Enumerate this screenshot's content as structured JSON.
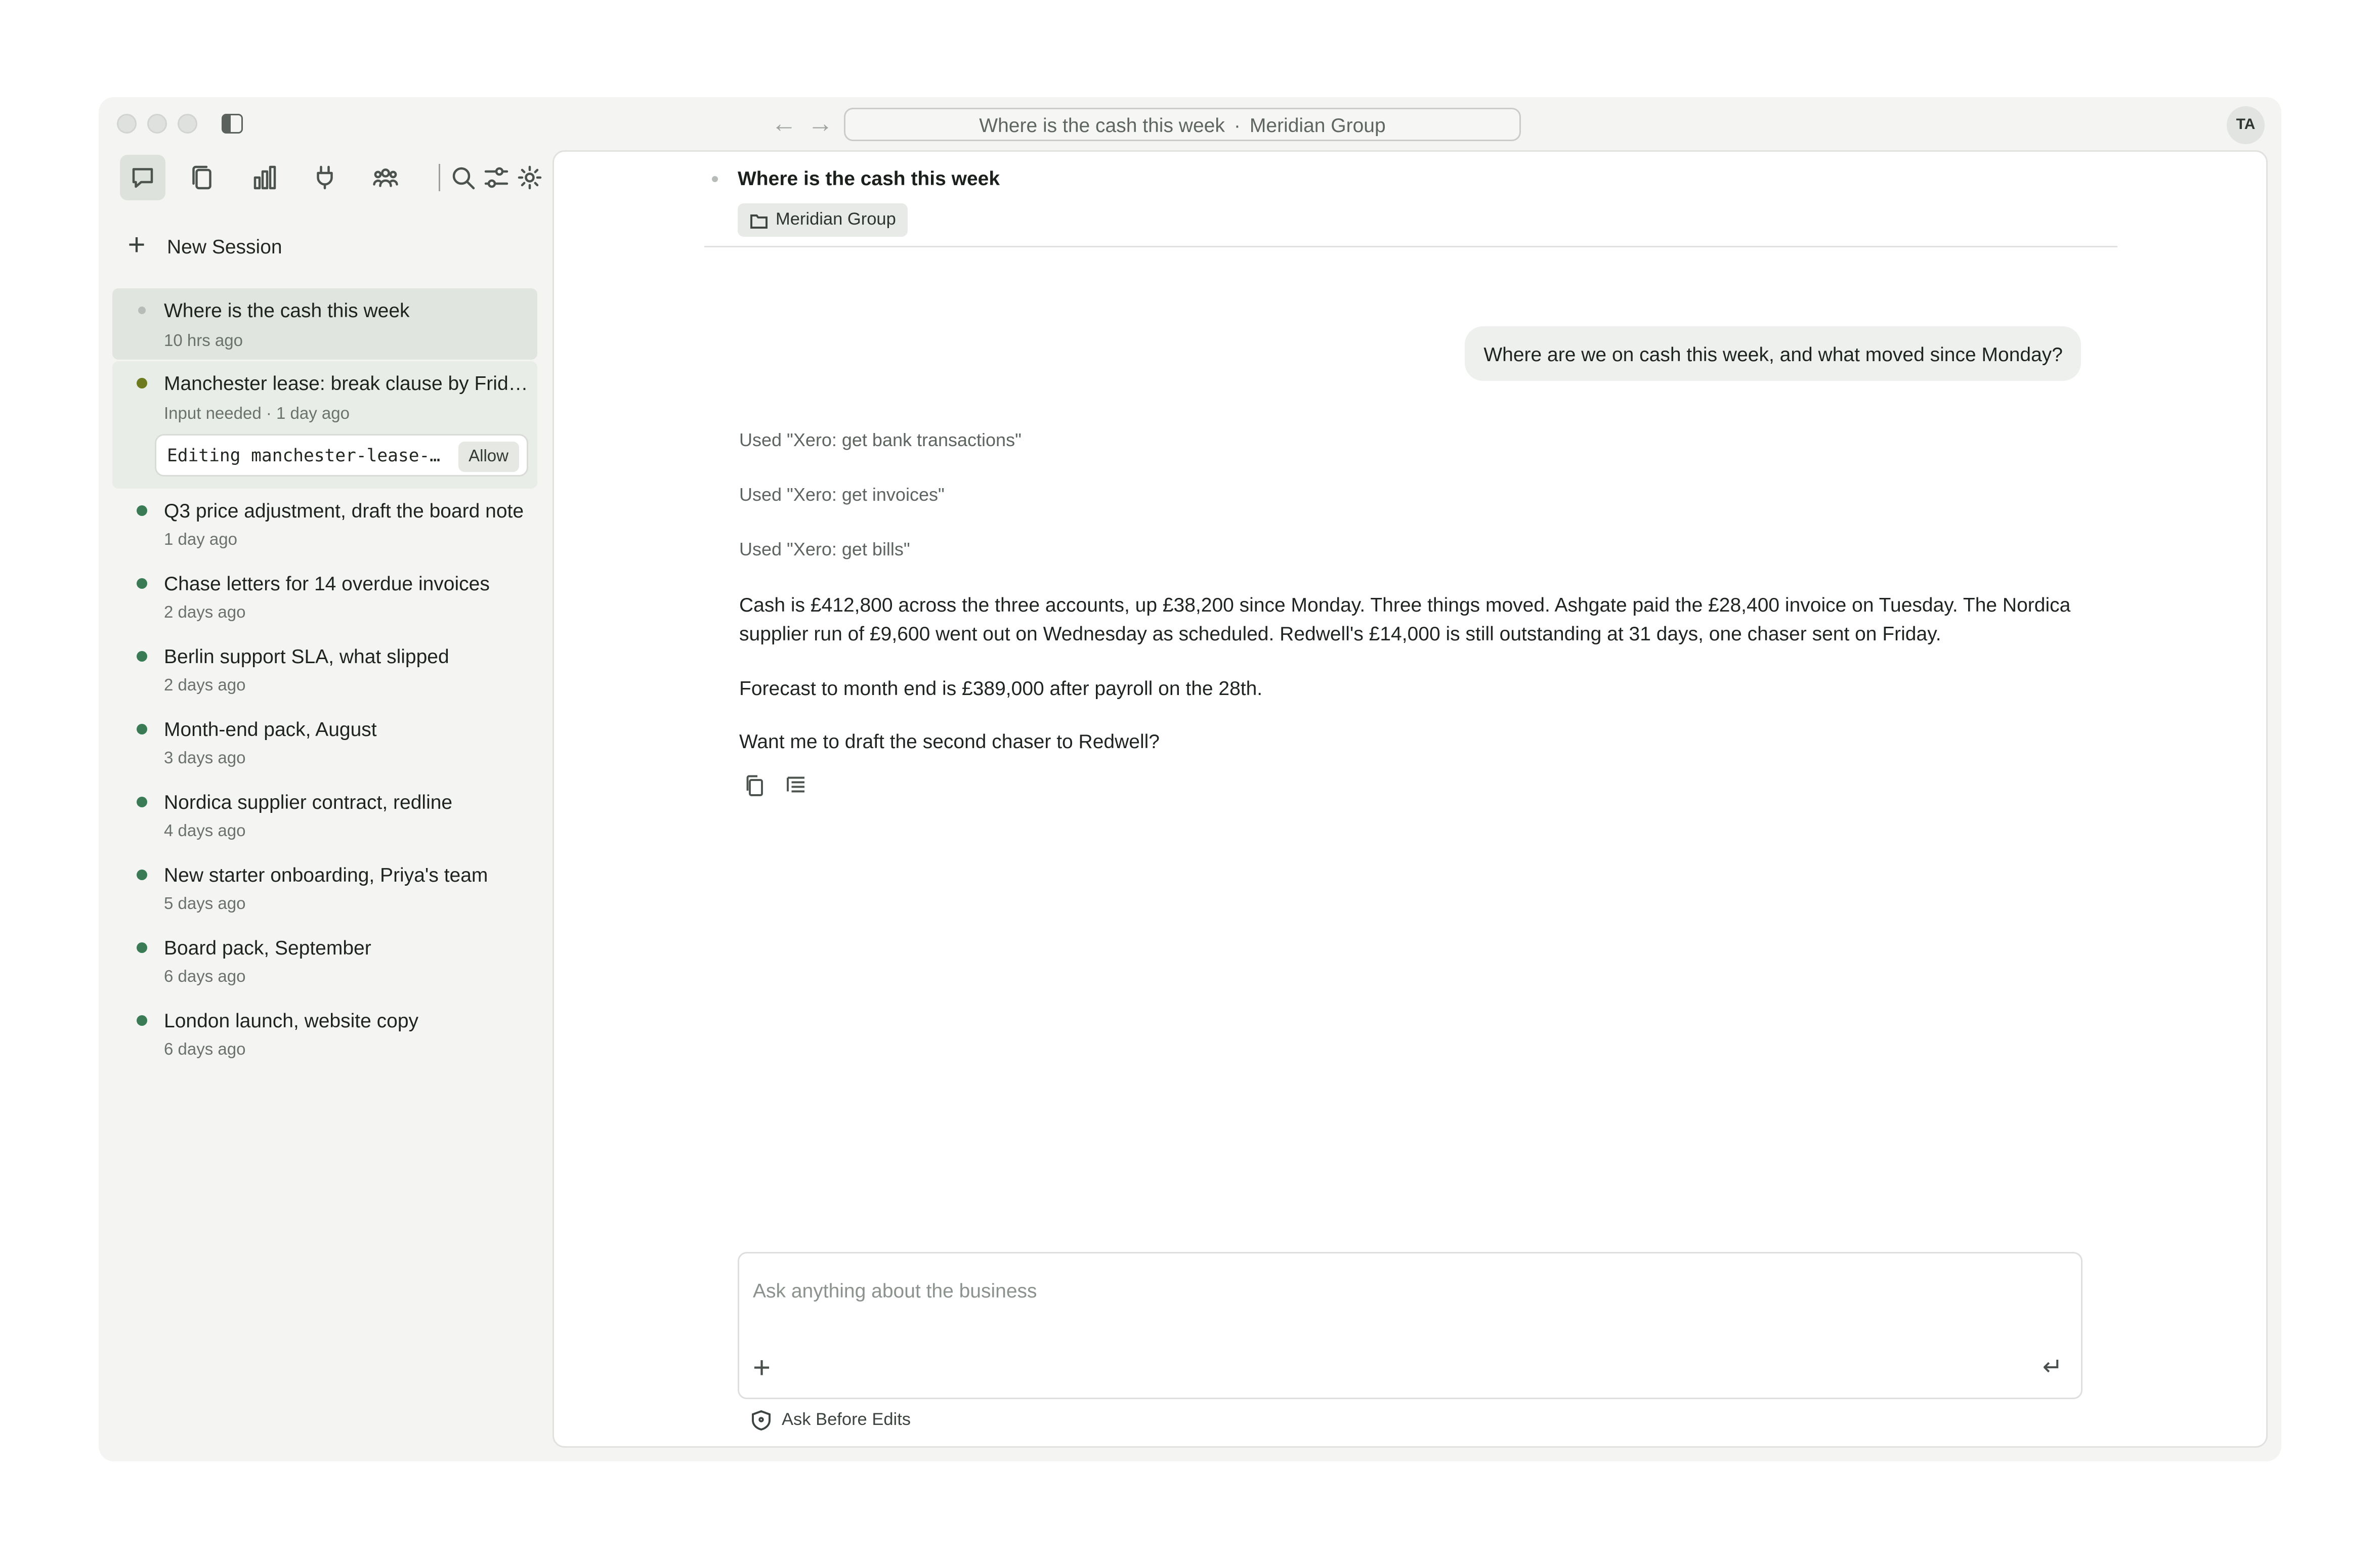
{
  "window": {
    "address_title": "Where is the cash this week",
    "address_separator": "·",
    "address_workspace": "Meridian Group",
    "avatar_initials": "TA"
  },
  "sidebar": {
    "toolbar_icons": [
      "chat-icon",
      "documents-icon",
      "chart-icon",
      "plug-icon",
      "team-icon",
      "search-icon",
      "sliders-icon",
      "gear-icon"
    ],
    "new_session_label": "New Session",
    "sessions": [
      {
        "title": "Where is the cash this week",
        "meta": "10 hrs ago",
        "status": "current"
      },
      {
        "title": "Manchester lease: break clause by Friday",
        "meta": "Input needed · 1 day ago",
        "status": "needs-input"
      },
      {
        "title": "Q3 price adjustment, draft the board note",
        "meta": "1 day ago",
        "status": "done"
      },
      {
        "title": "Chase letters for 14 overdue invoices",
        "meta": "2 days ago",
        "status": "done"
      },
      {
        "title": "Berlin support SLA, what slipped",
        "meta": "2 days ago",
        "status": "done"
      },
      {
        "title": "Month-end pack, August",
        "meta": "3 days ago",
        "status": "done"
      },
      {
        "title": "Nordica supplier contract, redline",
        "meta": "4 days ago",
        "status": "done"
      },
      {
        "title": "New starter onboarding, Priya's team",
        "meta": "5 days ago",
        "status": "done"
      },
      {
        "title": "Board pack, September",
        "meta": "6 days ago",
        "status": "done"
      },
      {
        "title": "London launch, website copy",
        "meta": "6 days ago",
        "status": "done"
      }
    ],
    "pending_edit": {
      "text": "Editing manchester-lease-notes.md",
      "allow_label": "Allow"
    }
  },
  "colors": {
    "status_done": "#3a7a55",
    "status_needs_input": "#6d7a1e",
    "status_current": "#b8bcb8",
    "selected_bg": "#e1e5e0",
    "pending_bg": "#e9ede7"
  },
  "chat": {
    "title": "Where is the cash this week",
    "folder": "Meridian Group",
    "user_message": "Where are we on cash this week, and what moved since Monday?",
    "tool_uses": [
      "Used \"Xero: get bank transactions\"",
      "Used \"Xero: get invoices\"",
      "Used \"Xero: get bills\""
    ],
    "answer_paragraphs": [
      "Cash is £412,800 across the three accounts, up £38,200 since Monday. Three things moved. Ashgate paid the £28,400 invoice on Tuesday. The Nordica supplier run of £9,600 went out on Wednesday as scheduled. Redwell's £14,000 is still outstanding at 31 days, one chaser sent on Friday.",
      "Forecast to month end is £389,000 after payroll on the 28th.",
      "Want me to draft the second chaser to Redwell?"
    ]
  },
  "composer": {
    "placeholder": "Ask anything about the business",
    "mode_label": "Ask Before Edits"
  }
}
